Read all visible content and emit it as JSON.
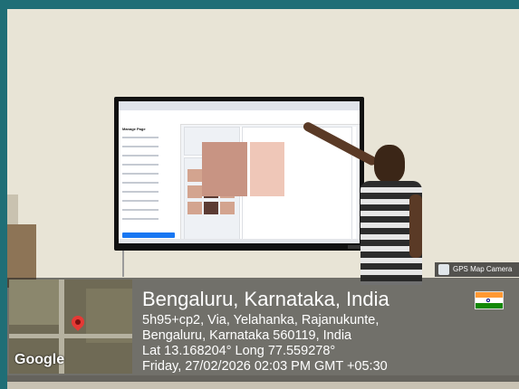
{
  "overlay": {
    "title": "Bengaluru, Karnataka, India",
    "address_line1": "5h95+cp2, Via, Yelahanka, Rajanukunte,",
    "address_line2": "Bengaluru, Karnataka 560119, India",
    "coords": "Lat 13.168204° Long 77.559278°",
    "datetime": "Friday, 27/02/2026 02:03 PM GMT +05:30",
    "map_brand": "Google",
    "app_badge": "GPS Map Camera",
    "flag": "india-flag-icon"
  },
  "screen": {
    "sidebar_title": "Manage Page"
  },
  "colors": {
    "facebook_blue": "#1877f2",
    "wall": "#e8e4d6",
    "frame": "#1f6e76"
  }
}
